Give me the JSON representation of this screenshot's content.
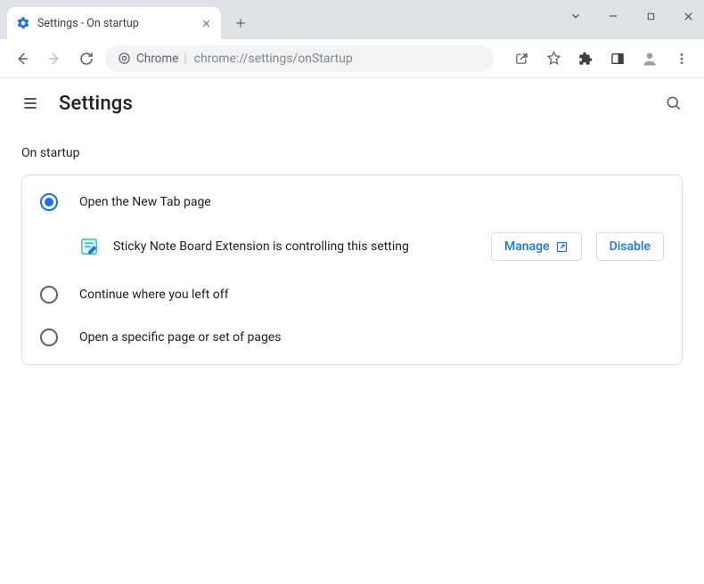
{
  "window": {
    "tab_title": "Settings - On startup"
  },
  "omnibox": {
    "security_label": "Chrome",
    "url": "chrome://settings/onStartup"
  },
  "header": {
    "title": "Settings"
  },
  "section": {
    "heading": "On startup",
    "options": {
      "new_tab": "Open the New Tab page",
      "continue": "Continue where you left off",
      "specific": "Open a specific page or set of pages"
    },
    "extension_notice": "Sticky Note Board Extension is controlling this setting",
    "manage_label": "Manage",
    "disable_label": "Disable"
  }
}
